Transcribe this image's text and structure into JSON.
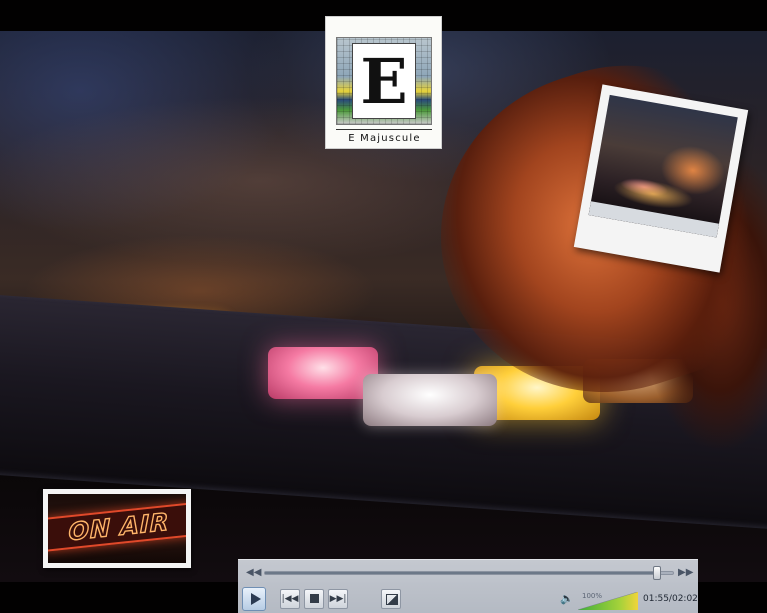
{
  "logo": {
    "letter": "E",
    "name": "E Majuscule"
  },
  "onair_sign": {
    "text": "ON AIR"
  },
  "player": {
    "progress_fraction": 0.96,
    "volume_label": "100%",
    "volume_fraction": 1.0,
    "time_display": "01:55/02:02",
    "icons": {
      "seek_back": "rewind-icon",
      "seek_forward": "fast-forward-icon",
      "play": "play-icon",
      "previous": "previous-track-icon",
      "stop": "stop-icon",
      "next": "next-track-icon",
      "fullscreen": "fullscreen-icon",
      "volume": "speaker-icon"
    }
  },
  "colors": {
    "key_pink": "#f57aa3",
    "key_yellow": "#ffcf3a",
    "onair_neon": "#e0492a",
    "player_bg": "#c8cdd6"
  }
}
